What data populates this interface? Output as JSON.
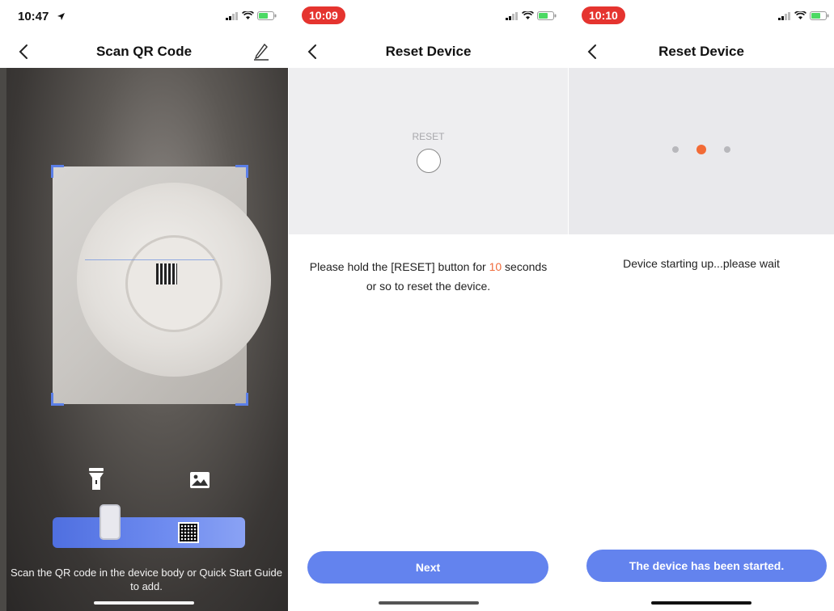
{
  "screen1": {
    "status_time": "10:47",
    "title": "Scan QR Code",
    "hint": "Scan the QR code in the device body or Quick Start Guide to add."
  },
  "screen2": {
    "status_time": "10:09",
    "title": "Reset Device",
    "reset_label": "RESET",
    "instruction_before": "Please hold the [RESET] button for ",
    "instruction_seconds": "10",
    "instruction_after": " seconds or so to reset the device.",
    "button": "Next"
  },
  "screen3": {
    "status_time": "10:10",
    "title": "Reset Device",
    "loading_dots": {
      "count": 3,
      "active_index": 1
    },
    "status": "Device starting up...please wait",
    "button": "The device has been started."
  },
  "colors": {
    "accent": "#6383ee",
    "highlight": "#f06a3a",
    "time_pill": "#e5342f",
    "scan_corner": "#5b7fe8"
  },
  "icons": [
    "back-icon",
    "edit-icon",
    "flashlight-icon",
    "album-icon",
    "signal-icon",
    "wifi-icon",
    "battery-icon",
    "location-arrow-icon"
  ]
}
